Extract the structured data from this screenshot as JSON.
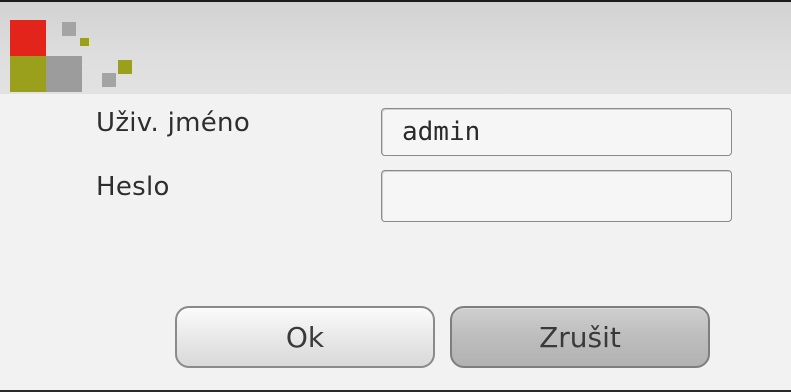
{
  "login": {
    "username_label": "Uživ. jméno",
    "username_value": "admin",
    "password_label": "Heslo",
    "password_value": ""
  },
  "buttons": {
    "ok_label": "Ok",
    "cancel_label": "Zrušit"
  },
  "colors": {
    "logo_red": "#e3241b",
    "logo_olive": "#9aa01c",
    "logo_gray": "#9c9c9c",
    "header_bg": "#d8d8d8",
    "body_bg": "#f2f2f2"
  }
}
